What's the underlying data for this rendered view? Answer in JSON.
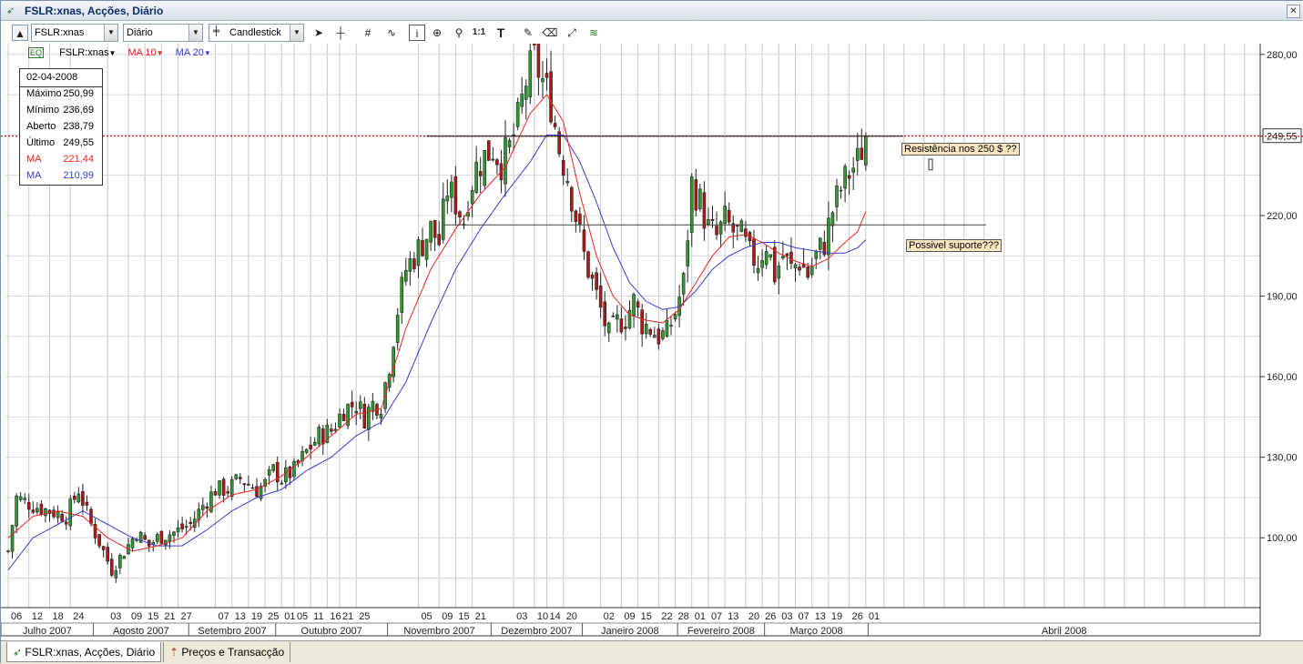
{
  "window": {
    "title": "FSLR:xnas, Acções, Diário",
    "close_glyph": "✕",
    "app_icon": "chart-arrow-icon"
  },
  "toolbar": {
    "symbol": "FSLR:xnas",
    "interval": "Diário",
    "chart_type": "Candlestick",
    "tools": [
      "cursor-icon",
      "crosshair-icon",
      "grid-icon",
      "indicator-icon",
      "info-icon",
      "zoom-box-icon",
      "zoom-icon",
      "one-to-one-icon",
      "text-icon",
      "draw-icon",
      "eraser-icon",
      "fit-icon",
      "layers-icon"
    ]
  },
  "legend": {
    "symbol": "FSLR:xnas",
    "ma1": "MA 10",
    "ma2": "MA 20",
    "colors": {
      "ma10": "#e8261f",
      "ma20": "#3b3bd8",
      "resistance": "#c00000"
    }
  },
  "infobox": {
    "date": "02-04-2008",
    "rows": [
      {
        "label": "Máximo",
        "value": "250,99",
        "color": "#000000"
      },
      {
        "label": "Mínimo",
        "value": "236,69",
        "color": "#000000"
      },
      {
        "label": "Aberto",
        "value": "238,79",
        "color": "#000000"
      },
      {
        "label": "Último",
        "value": "249,55",
        "color": "#000000"
      },
      {
        "label": "MA",
        "value": "221,44",
        "color": "#e8261f"
      },
      {
        "label": "MA",
        "value": "210,99",
        "color": "#3b3bd8"
      }
    ]
  },
  "annotations": {
    "resistance": "Resistência nos 250 $ ??",
    "support": "Possivel suporte???"
  },
  "current_price_label": "249,55",
  "tabs": [
    {
      "label": "FSLR:xnas, Acções, Diário",
      "icon": "chart-arrow-icon"
    },
    {
      "label": "Preços e Transacção",
      "icon": "price-icon"
    }
  ],
  "chart_data": {
    "type": "candlestick",
    "symbol": "FSLR:xnas",
    "y_ticks": [
      "280,00",
      "249,55",
      "220,00",
      "190,00",
      "160,00",
      "130,00",
      "100,00"
    ],
    "y_tick_values": [
      280,
      249.55,
      220,
      190,
      160,
      130,
      100
    ],
    "ylim": [
      74,
      284
    ],
    "resistance_level": 249.55,
    "support_level": 216.5,
    "day_labels": [
      "06",
      "12",
      "18",
      "24",
      "03",
      "09",
      "15",
      "21",
      "27",
      "07",
      "13",
      "19",
      "25",
      "01",
      "05",
      "11",
      "16",
      "21",
      "25",
      "05",
      "09",
      "15",
      "21",
      "03",
      "10",
      "14",
      "20",
      "02",
      "09",
      "15",
      "22",
      "28",
      "01",
      "07",
      "13",
      "20",
      "26",
      "03",
      "07",
      "13",
      "19",
      "26",
      "01"
    ],
    "month_labels": [
      "Julho 2007",
      "Agosto 2007",
      "Setembro 2007",
      "Outubro 2007",
      "Novembro 2007",
      "Dezembro 2007",
      "Janeiro 2008",
      "Fevereiro 2008",
      "Março 2008",
      "Abril 2008"
    ],
    "close_path": [
      [
        0,
        95
      ],
      [
        2,
        115
      ],
      [
        6,
        112
      ],
      [
        10,
        110
      ],
      [
        14,
        108
      ],
      [
        17,
        118
      ],
      [
        20,
        105
      ],
      [
        23,
        95
      ],
      [
        25,
        88
      ],
      [
        28,
        95
      ],
      [
        31,
        102
      ],
      [
        34,
        97
      ],
      [
        36,
        100
      ],
      [
        40,
        102
      ],
      [
        44,
        105
      ],
      [
        47,
        112
      ],
      [
        50,
        118
      ],
      [
        53,
        118
      ],
      [
        56,
        122
      ],
      [
        58,
        120
      ],
      [
        60,
        118
      ],
      [
        62,
        120
      ],
      [
        64,
        125
      ],
      [
        66,
        122
      ],
      [
        69,
        125
      ],
      [
        72,
        132
      ],
      [
        75,
        138
      ],
      [
        78,
        140
      ],
      [
        81,
        148
      ],
      [
        84,
        150
      ],
      [
        86,
        145
      ],
      [
        88,
        150
      ],
      [
        90,
        150
      ],
      [
        92,
        165
      ],
      [
        94,
        185
      ],
      [
        96,
        200
      ],
      [
        98,
        205
      ],
      [
        100,
        210
      ],
      [
        102,
        215
      ],
      [
        104,
        210
      ],
      [
        106,
        230
      ],
      [
        108,
        225
      ],
      [
        110,
        218
      ],
      [
        111,
        228
      ],
      [
        113,
        238
      ],
      [
        115,
        242
      ],
      [
        117,
        245
      ],
      [
        119,
        240
      ],
      [
        121,
        245
      ],
      [
        123,
        255
      ],
      [
        125,
        270
      ],
      [
        127,
        278
      ],
      [
        129,
        270
      ],
      [
        131,
        262
      ],
      [
        133,
        245
      ],
      [
        135,
        235
      ],
      [
        137,
        220
      ],
      [
        139,
        205
      ],
      [
        141,
        195
      ],
      [
        143,
        185
      ],
      [
        145,
        175
      ],
      [
        147,
        180
      ],
      [
        149,
        182
      ],
      [
        151,
        188
      ],
      [
        153,
        180
      ],
      [
        155,
        178
      ],
      [
        157,
        175
      ],
      [
        159,
        176
      ],
      [
        161,
        184
      ],
      [
        163,
        195
      ],
      [
        165,
        232
      ],
      [
        167,
        225
      ],
      [
        169,
        215
      ],
      [
        171,
        212
      ],
      [
        173,
        218
      ],
      [
        175,
        214
      ],
      [
        177,
        212
      ],
      [
        179,
        205
      ],
      [
        181,
        203
      ],
      [
        183,
        210
      ],
      [
        185,
        198
      ],
      [
        187,
        205
      ],
      [
        189,
        200
      ],
      [
        191,
        203
      ],
      [
        193,
        198
      ],
      [
        195,
        205
      ],
      [
        197,
        210
      ],
      [
        199,
        222
      ],
      [
        201,
        230
      ],
      [
        203,
        236
      ],
      [
        205,
        240
      ],
      [
        207,
        249.55
      ]
    ],
    "ma10_path": [
      [
        0,
        100
      ],
      [
        6,
        108
      ],
      [
        12,
        110
      ],
      [
        18,
        108
      ],
      [
        24,
        100
      ],
      [
        30,
        95
      ],
      [
        36,
        97
      ],
      [
        42,
        100
      ],
      [
        48,
        110
      ],
      [
        54,
        116
      ],
      [
        60,
        118
      ],
      [
        66,
        123
      ],
      [
        72,
        130
      ],
      [
        78,
        138
      ],
      [
        84,
        146
      ],
      [
        90,
        148
      ],
      [
        96,
        178
      ],
      [
        102,
        200
      ],
      [
        108,
        215
      ],
      [
        114,
        228
      ],
      [
        120,
        238
      ],
      [
        126,
        258
      ],
      [
        130,
        265
      ],
      [
        134,
        255
      ],
      [
        138,
        228
      ],
      [
        142,
        205
      ],
      [
        146,
        190
      ],
      [
        150,
        183
      ],
      [
        154,
        181
      ],
      [
        158,
        180
      ],
      [
        162,
        185
      ],
      [
        166,
        195
      ],
      [
        170,
        205
      ],
      [
        174,
        212
      ],
      [
        178,
        213
      ],
      [
        182,
        210
      ],
      [
        186,
        206
      ],
      [
        190,
        203
      ],
      [
        194,
        201
      ],
      [
        198,
        204
      ],
      [
        202,
        210
      ],
      [
        205,
        214
      ],
      [
        207,
        221.44
      ]
    ],
    "ma20_path": [
      [
        0,
        88
      ],
      [
        6,
        100
      ],
      [
        12,
        105
      ],
      [
        18,
        110
      ],
      [
        24,
        105
      ],
      [
        30,
        100
      ],
      [
        36,
        97
      ],
      [
        42,
        97
      ],
      [
        48,
        103
      ],
      [
        54,
        110
      ],
      [
        60,
        115
      ],
      [
        66,
        118
      ],
      [
        72,
        125
      ],
      [
        78,
        130
      ],
      [
        84,
        138
      ],
      [
        90,
        143
      ],
      [
        96,
        158
      ],
      [
        102,
        180
      ],
      [
        108,
        200
      ],
      [
        114,
        215
      ],
      [
        120,
        228
      ],
      [
        126,
        240
      ],
      [
        130,
        250
      ],
      [
        134,
        250
      ],
      [
        138,
        240
      ],
      [
        142,
        225
      ],
      [
        146,
        208
      ],
      [
        150,
        195
      ],
      [
        154,
        188
      ],
      [
        158,
        185
      ],
      [
        162,
        186
      ],
      [
        166,
        192
      ],
      [
        170,
        200
      ],
      [
        174,
        205
      ],
      [
        178,
        208
      ],
      [
        182,
        210
      ],
      [
        186,
        210
      ],
      [
        190,
        208
      ],
      [
        194,
        207
      ],
      [
        198,
        206
      ],
      [
        202,
        206
      ],
      [
        205,
        208
      ],
      [
        207,
        210.99
      ]
    ]
  }
}
